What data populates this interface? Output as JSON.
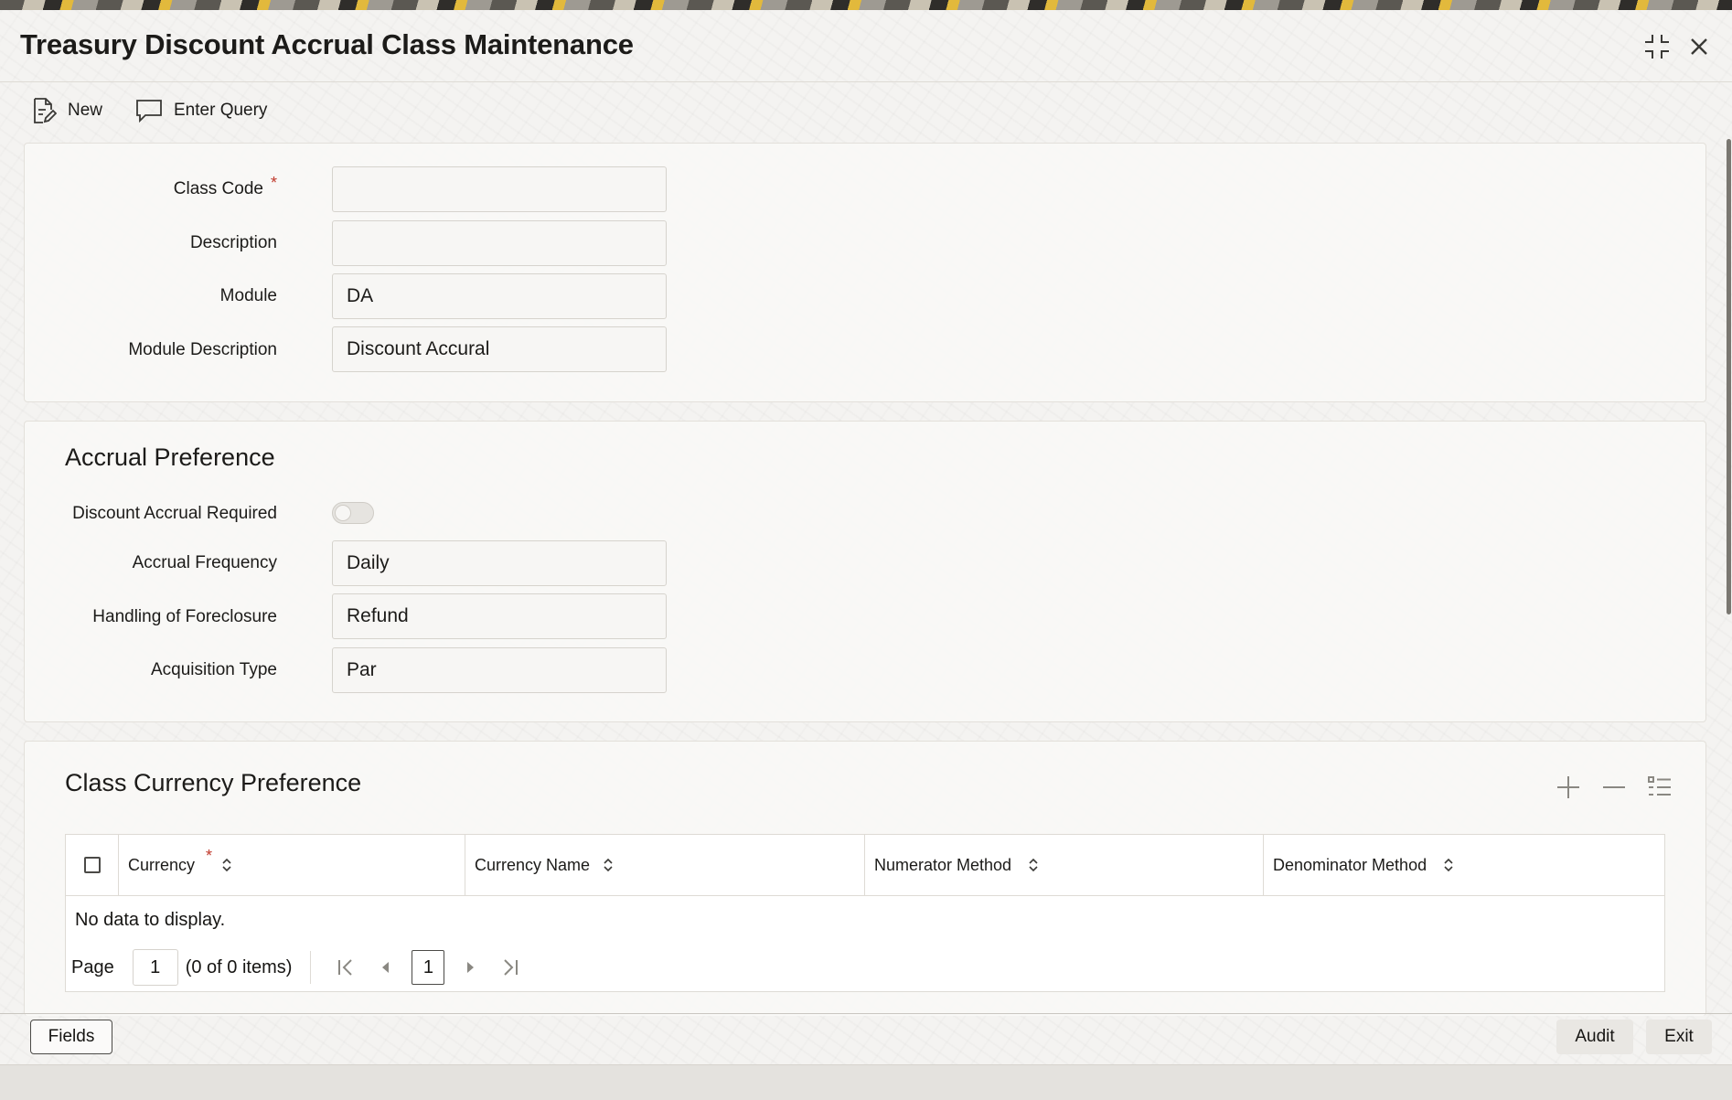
{
  "window": {
    "title": "Treasury Discount Accrual Class Maintenance"
  },
  "toolbar": {
    "new_label": "New",
    "enter_query_label": "Enter Query"
  },
  "class_details": {
    "class_code": {
      "label": "Class Code",
      "required_mark": "*",
      "value": ""
    },
    "description": {
      "label": "Description",
      "value": ""
    },
    "module": {
      "label": "Module",
      "value": "DA"
    },
    "module_description": {
      "label": "Module Description",
      "value": "Discount Accural"
    }
  },
  "accrual_preference": {
    "title": "Accrual Preference",
    "discount_accrual_required": {
      "label": "Discount Accrual Required",
      "checked": false
    },
    "accrual_frequency": {
      "label": "Accrual Frequency",
      "value": "Daily"
    },
    "handling_of_foreclosure": {
      "label": "Handling of Foreclosure",
      "value": "Refund"
    },
    "acquisition_type": {
      "label": "Acquisition Type",
      "value": "Par"
    }
  },
  "class_currency_preference": {
    "title": "Class Currency Preference",
    "columns": [
      {
        "label": "Currency",
        "required_mark": "*"
      },
      {
        "label": "Currency Name"
      },
      {
        "label": "Numerator Method"
      },
      {
        "label": "Denominator Method"
      }
    ],
    "rows": [],
    "empty_text": "No data to display.",
    "pagination": {
      "page_label": "Page",
      "page_input": "1",
      "summary": "(0 of 0 items)",
      "current_page": "1"
    }
  },
  "footer": {
    "fields_label": "Fields",
    "audit_label": "Audit",
    "exit_label": "Exit"
  },
  "colors": {
    "required": "#c0392b",
    "text": "#1c1b19",
    "panel_bg": "#f9f8f6",
    "border": "#dedbd5"
  }
}
